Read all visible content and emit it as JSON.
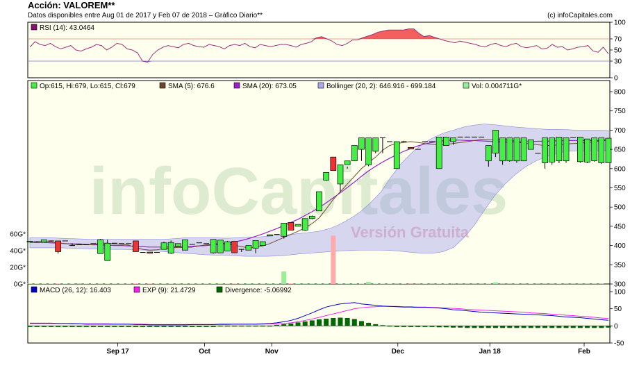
{
  "header": {
    "title": "Acción: VALOREM**",
    "subtitle": "Datos disponibles entre Aug 01 de 2017 y Feb 07 de 2018 – Gráfico Diario**",
    "credit": "(c) infoCapitales.com"
  },
  "watermark": {
    "brand": "infoCapitales",
    "edition": "Versión Gratuita"
  },
  "colors": {
    "panel_bg": "#ffffee",
    "candle_up": "#44ee44",
    "candle_down": "#ee3333",
    "sma5": "#6b4a2a",
    "sma20": "#9a1fc8",
    "bollinger": "#9999ee",
    "rsi_line": "#a0307a",
    "rsi_fill": "#ee4444",
    "macd": "#0000cc",
    "signal": "#ee22ee",
    "divergence": "#006600"
  },
  "x_axis": {
    "ticks": [
      "Sep 17",
      "Oct",
      "Nov",
      "Dec",
      "Jan 18",
      "Feb"
    ]
  },
  "chart_data": [
    {
      "type": "line",
      "panel": "rsi",
      "legend": "RSI (14): 43.0464",
      "ylim": [
        0,
        100
      ],
      "yticks": [
        "100",
        "70",
        "50",
        "30",
        "0"
      ],
      "levels": [
        30,
        70
      ],
      "values": [
        55,
        65,
        60,
        58,
        62,
        56,
        52,
        55,
        58,
        50,
        48,
        52,
        55,
        60,
        58,
        50,
        55,
        62,
        60,
        52,
        50,
        45,
        30,
        28,
        42,
        50,
        55,
        58,
        56,
        54,
        60,
        62,
        58,
        56,
        55,
        60,
        58,
        56,
        52,
        58,
        60,
        58,
        62,
        56,
        54,
        60,
        58,
        56,
        58,
        60,
        60,
        58,
        55,
        60,
        62,
        65,
        72,
        74,
        70,
        66,
        60,
        58,
        62,
        68,
        68,
        72,
        75,
        78,
        82,
        84,
        86,
        86,
        86,
        86,
        88,
        88,
        80,
        74,
        76,
        73,
        70,
        67,
        65,
        63,
        66,
        64,
        62,
        60,
        57,
        56,
        60,
        62,
        58,
        56,
        60,
        62,
        56,
        54,
        56,
        58,
        52,
        53,
        60,
        55,
        56,
        50,
        52,
        55,
        56,
        58,
        48,
        46,
        55,
        43
      ]
    },
    {
      "type": "candlestick",
      "panel": "price",
      "legend": {
        "ohlc": "Op:615, Hi:679, Lo:615, Cl:679",
        "sma5": "SMA (5): 676.6",
        "sma20": "SMA (20): 673.05",
        "bollinger": "Bollinger (20, 2): 646.916 - 699.184",
        "volume": "Vol: 0.004711G*"
      },
      "ylim": [
        300,
        800
      ],
      "yticks": [
        "800",
        "750",
        "700",
        "650",
        "600",
        "550",
        "500",
        "450",
        "400",
        "350",
        "300"
      ],
      "volume_ticks": [
        "60G*",
        "40G*",
        "20G*",
        "0G*"
      ],
      "candles": [
        [
          409,
          411,
          409,
          411
        ],
        [
          409,
          411,
          409,
          409
        ],
        [
          409,
          415,
          409,
          415
        ],
        [
          411,
          412,
          411,
          412
        ],
        [
          412,
          412,
          379,
          384
        ],
        [
          412,
          412,
          412,
          412
        ],
        [
          400,
          406,
          399,
          400
        ],
        [
          402,
          403,
          402,
          403
        ],
        [
          402,
          402,
          402,
          402
        ],
        [
          405,
          405,
          405,
          405
        ],
        [
          379,
          417,
          379,
          415
        ],
        [
          361,
          415,
          361,
          406
        ],
        [
          406,
          406,
          406,
          406
        ],
        [
          405,
          405,
          405,
          405
        ],
        [
          405,
          405,
          405,
          405
        ],
        [
          412,
          412,
          384,
          384
        ],
        [
          382,
          382,
          382,
          382
        ],
        [
          383,
          383,
          380,
          380
        ],
        [
          382,
          382,
          382,
          382
        ],
        [
          390,
          410,
          390,
          407
        ],
        [
          380,
          413,
          378,
          408
        ],
        [
          398,
          405,
          398,
          405
        ],
        [
          388,
          412,
          388,
          415
        ],
        [
          403,
          403,
          403,
          403
        ],
        [
          407,
          407,
          407,
          407
        ],
        [
          405,
          405,
          405,
          405
        ],
        [
          381,
          416,
          379,
          416
        ],
        [
          381,
          413,
          381,
          414
        ],
        [
          386,
          412,
          386,
          410
        ],
        [
          411,
          411,
          381,
          381
        ],
        [
          390,
          390,
          383,
          390
        ],
        [
          388,
          400,
          388,
          400
        ],
        [
          393,
          413,
          380,
          413
        ],
        [
          400,
          410,
          400,
          410
        ],
        [
          425,
          428,
          425,
          428
        ],
        [
          429,
          429,
          429,
          429
        ],
        [
          424,
          450,
          418,
          458
        ],
        [
          460,
          460,
          440,
          440
        ],
        [
          450,
          455,
          450,
          455
        ],
        [
          440,
          470,
          438,
          470
        ],
        [
          470,
          478,
          468,
          476
        ],
        [
          490,
          540,
          490,
          540
        ],
        [
          570,
          590,
          568,
          590
        ],
        [
          630,
          630,
          595,
          595
        ],
        [
          560,
          560,
          540,
          610
        ],
        [
          610,
          605,
          600,
          620
        ],
        [
          620,
          660,
          620,
          660
        ],
        [
          650,
          680,
          620,
          680
        ],
        [
          610,
          680,
          606,
          680
        ],
        [
          645,
          680,
          640,
          680
        ],
        [
          680,
          680,
          640,
          680
        ],
        [
          670,
          670,
          670,
          670
        ],
        [
          600,
          670,
          600,
          670
        ],
        [
          670,
          672,
          670,
          670
        ],
        [
          655,
          655,
          651,
          651
        ],
        [
          650,
          650,
          650,
          650
        ],
        [
          670,
          670,
          670,
          670
        ],
        [
          670,
          670,
          670,
          670
        ],
        [
          600,
          680,
          600,
          682
        ],
        [
          660,
          681,
          660,
          682
        ],
        [
          670,
          680,
          662,
          680
        ],
        [
          682,
          682,
          682,
          682
        ],
        [
          682,
          682,
          682,
          682
        ],
        [
          682,
          682,
          682,
          682
        ],
        [
          682,
          682,
          682,
          682
        ],
        [
          620,
          660,
          605,
          660
        ],
        [
          640,
          700,
          630,
          700
        ],
        [
          620,
          680,
          610,
          680
        ],
        [
          620,
          680,
          618,
          680
        ],
        [
          620,
          680,
          615,
          680
        ],
        [
          620,
          680,
          620,
          680
        ],
        [
          650,
          675,
          650,
          675
        ],
        [
          640,
          640,
          640,
          640
        ],
        [
          615,
          680,
          600,
          680
        ],
        [
          617,
          680,
          610,
          680
        ],
        [
          620,
          680,
          614,
          682
        ],
        [
          620,
          680,
          615,
          680
        ],
        [
          680,
          680,
          680,
          680
        ],
        [
          618,
          682,
          615,
          682
        ],
        [
          617,
          677,
          614,
          677
        ],
        [
          620,
          680,
          618,
          680
        ],
        [
          615,
          680,
          612,
          680
        ],
        [
          615,
          679,
          615,
          679
        ]
      ],
      "sma5": [
        409,
        410,
        410,
        410,
        407,
        405,
        403,
        402,
        402,
        402,
        406,
        406,
        404,
        403,
        401,
        395,
        390,
        388,
        389,
        392,
        394,
        395,
        395,
        396,
        399,
        402,
        404,
        405,
        404,
        401,
        397,
        394,
        396,
        399,
        405,
        413,
        421,
        429,
        437,
        446,
        457,
        472,
        495,
        520,
        540,
        560,
        580,
        600,
        615,
        630,
        648,
        660,
        665,
        668,
        670,
        668,
        665,
        663,
        662,
        663,
        665,
        668,
        670,
        673,
        676,
        675,
        675,
        675,
        674,
        670,
        665,
        665,
        662,
        660,
        660,
        662,
        664,
        665,
        666,
        668,
        669,
        673,
        676.6
      ],
      "sma20": [
        408,
        408,
        408,
        407,
        406,
        405,
        404,
        404,
        403,
        402,
        402,
        401,
        400,
        400,
        399,
        398,
        397,
        396,
        396,
        396,
        396,
        397,
        397,
        398,
        399,
        400,
        402,
        404,
        406,
        409,
        413,
        418,
        424,
        430,
        437,
        444,
        452,
        460,
        468,
        478,
        488,
        499,
        511,
        524,
        537,
        551,
        565,
        580,
        594,
        606,
        617,
        627,
        636,
        645,
        652,
        659,
        664,
        668,
        671,
        673,
        674,
        674,
        673,
        673,
        672,
        671,
        670,
        669,
        669,
        669,
        670,
        670,
        671,
        671,
        672,
        672,
        673,
        673,
        673,
        673,
        673,
        673,
        673.05
      ],
      "bollinger_upper": [
        420,
        420,
        420,
        419,
        418,
        417,
        416,
        416,
        416,
        416,
        416,
        416,
        416,
        416,
        418,
        420,
        420,
        420,
        420,
        419,
        420,
        421,
        422,
        424,
        426,
        428,
        431,
        434,
        437,
        444,
        455,
        470,
        488,
        512,
        540,
        580,
        615,
        642,
        664,
        680,
        692,
        700,
        708,
        713,
        716,
        714,
        711,
        708,
        706,
        704,
        702,
        702,
        701,
        700,
        700,
        700,
        699.2
      ],
      "bollinger_lower": [
        394,
        394,
        394,
        394,
        393,
        392,
        391,
        391,
        390,
        390,
        389,
        388,
        386,
        384,
        382,
        380,
        378,
        376,
        375,
        374,
        373,
        372,
        372,
        372,
        373,
        375,
        378,
        380,
        382,
        384,
        386,
        387,
        388,
        388,
        388,
        387,
        385,
        382,
        380,
        380,
        384,
        395,
        420,
        452,
        492,
        530,
        560,
        585,
        605,
        620,
        631,
        640,
        645,
        646,
        646,
        646,
        646.9
      ],
      "volume_gstar": [
        0.6,
        0.5,
        0.5,
        0.4,
        0.5,
        0.4,
        0.4,
        0.3,
        0.5,
        0.4,
        0.6,
        0.4,
        0.5,
        0.4,
        0.5,
        0.6,
        0.4,
        0.5,
        0.4,
        0.5,
        0.4,
        0.6,
        0.5,
        0.4,
        0.5,
        0.5,
        0.4,
        0.6,
        0.4,
        0.5,
        0.4,
        0.6,
        0.5,
        0.5,
        0.6,
        0.5,
        15,
        0.6,
        0.5,
        0.7,
        0.6,
        0.5,
        0.6,
        58,
        0.5,
        0.6,
        0.5,
        0.4,
        2.5,
        0.4,
        0.5,
        0.4,
        0.3,
        0.4,
        0.3,
        0.3,
        0.4,
        0.3,
        0.4,
        0.4,
        0.3,
        0.3,
        0.3,
        0.3,
        0.3,
        0.4,
        2,
        0.3,
        0.3,
        0.4,
        0.3,
        0.4,
        0.3,
        0.3,
        0.3,
        0.4,
        0.3,
        0.3,
        0.3,
        0.3,
        0.3,
        0.3,
        0.004711
      ]
    },
    {
      "type": "line",
      "panel": "macd",
      "legend": {
        "macd": "MACD (26, 12): 16.403",
        "signal": "EXP (9): 21.4729",
        "divergence": "Divergence: -5.06992"
      },
      "ylim": [
        -50,
        100
      ],
      "yticks": [
        "100",
        "50",
        "0",
        "-50"
      ],
      "macd": [
        8,
        8,
        8,
        8,
        7,
        7,
        6,
        6,
        5,
        5,
        5,
        5,
        5,
        5,
        5,
        4,
        4,
        3,
        3,
        3,
        3,
        3,
        3,
        4,
        4,
        4,
        4,
        5,
        5,
        5,
        5,
        5,
        5,
        6,
        7,
        9,
        12,
        16,
        22,
        30,
        38,
        47,
        55,
        60,
        64,
        66,
        68,
        64,
        62,
        60,
        58,
        57,
        56,
        55,
        55,
        54,
        54,
        53,
        52,
        50,
        47,
        46,
        44,
        42,
        40,
        39,
        38,
        37,
        36,
        35,
        34,
        33,
        32,
        31,
        30,
        28,
        26,
        25,
        24,
        22,
        20,
        18,
        16.403
      ],
      "signal": [
        7,
        7,
        7,
        7,
        7,
        7,
        7,
        6,
        6,
        6,
        6,
        6,
        5,
        5,
        5,
        5,
        5,
        4,
        4,
        4,
        4,
        4,
        4,
        4,
        4,
        4,
        4,
        4,
        4,
        5,
        5,
        5,
        5,
        5,
        6,
        6,
        7,
        9,
        12,
        16,
        20,
        25,
        30,
        35,
        40,
        45,
        50,
        53,
        55,
        56,
        57,
        57,
        57,
        56,
        56,
        55,
        55,
        54,
        53,
        52,
        51,
        50,
        48,
        47,
        46,
        45,
        44,
        43,
        42,
        41,
        40,
        38,
        37,
        36,
        34,
        33,
        31,
        30,
        28,
        27,
        25,
        23,
        21.4729
      ],
      "divergence": [
        0,
        0,
        0,
        0,
        0,
        -1,
        -1,
        -1,
        -1,
        -1,
        -1,
        -1,
        -1,
        -1,
        -1,
        -1,
        -1,
        -1,
        -1,
        -1,
        -1,
        -1,
        -1,
        0,
        0,
        0,
        0,
        1,
        1,
        1,
        1,
        1,
        1,
        1,
        1,
        3,
        5,
        7,
        10,
        13,
        16,
        19,
        21,
        23,
        24,
        23,
        20,
        14,
        9,
        5,
        2,
        1,
        -1,
        -2,
        -2,
        -3,
        -3,
        -3,
        -4,
        -4,
        -5,
        -5,
        -6,
        -6,
        -6,
        -6,
        -6,
        -6,
        -6,
        -6,
        -6,
        -6,
        -6,
        -6,
        -6,
        -6,
        -6,
        -6,
        -6,
        -6,
        -6,
        -6,
        -5.07
      ]
    }
  ]
}
